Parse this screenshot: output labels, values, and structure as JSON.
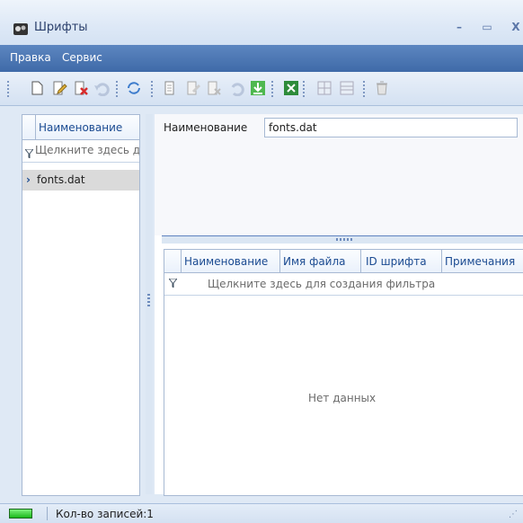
{
  "window": {
    "title": "Шрифты",
    "minimize": "–",
    "maximize": "▭",
    "close": "X"
  },
  "menu": {
    "edit": "Правка",
    "service": "Сервис"
  },
  "toolbar": {
    "icons": [
      "new-icon",
      "edit-icon",
      "delete-icon",
      "undo-icon",
      "refresh-icon",
      "copy-icon",
      "edit-doc-icon",
      "doc-icon",
      "undo-doc-icon",
      "download-icon",
      "excel-icon",
      "insert-row-icon",
      "delete-row-icon",
      "trash-icon"
    ]
  },
  "left_list": {
    "column_header": "Наименование",
    "filter_text": "Щелкните здесь для создания фильтра",
    "rows": [
      {
        "label": "fonts.dat",
        "selected": true
      }
    ]
  },
  "detail": {
    "name_label": "Наименование",
    "name_value": "fonts.dat"
  },
  "grid": {
    "columns": [
      "Наименование",
      "Имя файла",
      "ID шрифта",
      "Примечания"
    ],
    "filter_text": "Щелкните здесь для создания фильтра",
    "empty_text": "Нет данных"
  },
  "status": {
    "records_text": "Кол-во записей:1",
    "led_color": "#22c022"
  },
  "colors": {
    "menu_bar": "#4a76b2",
    "accent": "#1a4a91"
  }
}
